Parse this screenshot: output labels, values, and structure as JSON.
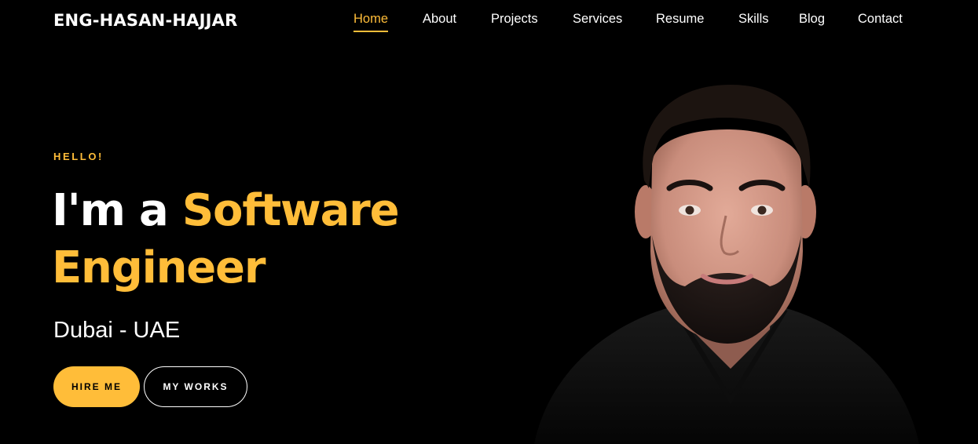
{
  "header": {
    "brand": "ENG-HASAN-HAJJAR",
    "nav": [
      {
        "label": "Home",
        "active": true
      },
      {
        "label": "About"
      },
      {
        "label": "Projects"
      },
      {
        "label": "Services"
      },
      {
        "label": "Resume"
      },
      {
        "label": "Skills"
      },
      {
        "label": "Blog"
      },
      {
        "label": "Contact"
      }
    ]
  },
  "hero": {
    "greeting": "HELLO!",
    "headline_prefix": "I'm a ",
    "headline_accent": "Software Engineer",
    "location": "Dubai - UAE",
    "hire_button": "HIRE ME",
    "works_button": "MY WORKS"
  },
  "colors": {
    "background": "#000000",
    "accent": "#ffbd39",
    "text": "#ffffff"
  }
}
